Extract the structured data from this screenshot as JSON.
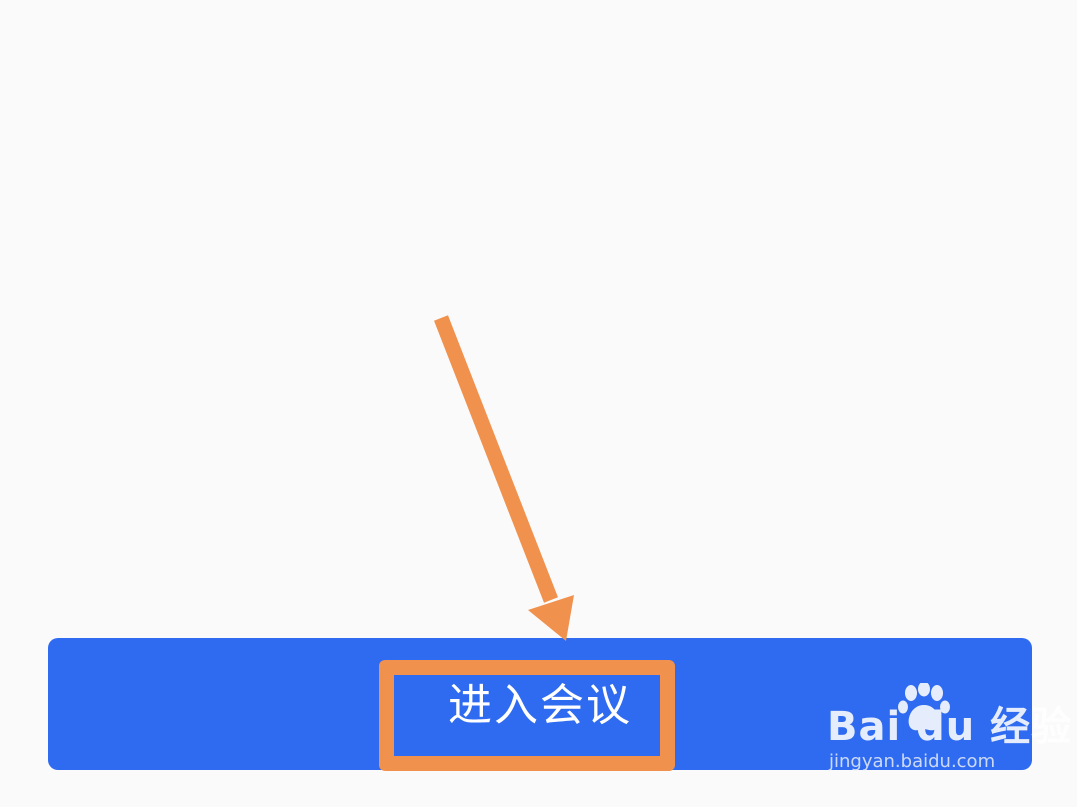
{
  "join_button": {
    "label": "进入会议"
  },
  "annotation": {
    "color": "#f0924d"
  },
  "watermark": {
    "brand": "Bai du 经验",
    "url": "jingyan.baidu.com"
  },
  "colors": {
    "button_blue": "#2f6bf0",
    "background": "#fbfafb",
    "text": "#ffffff"
  }
}
